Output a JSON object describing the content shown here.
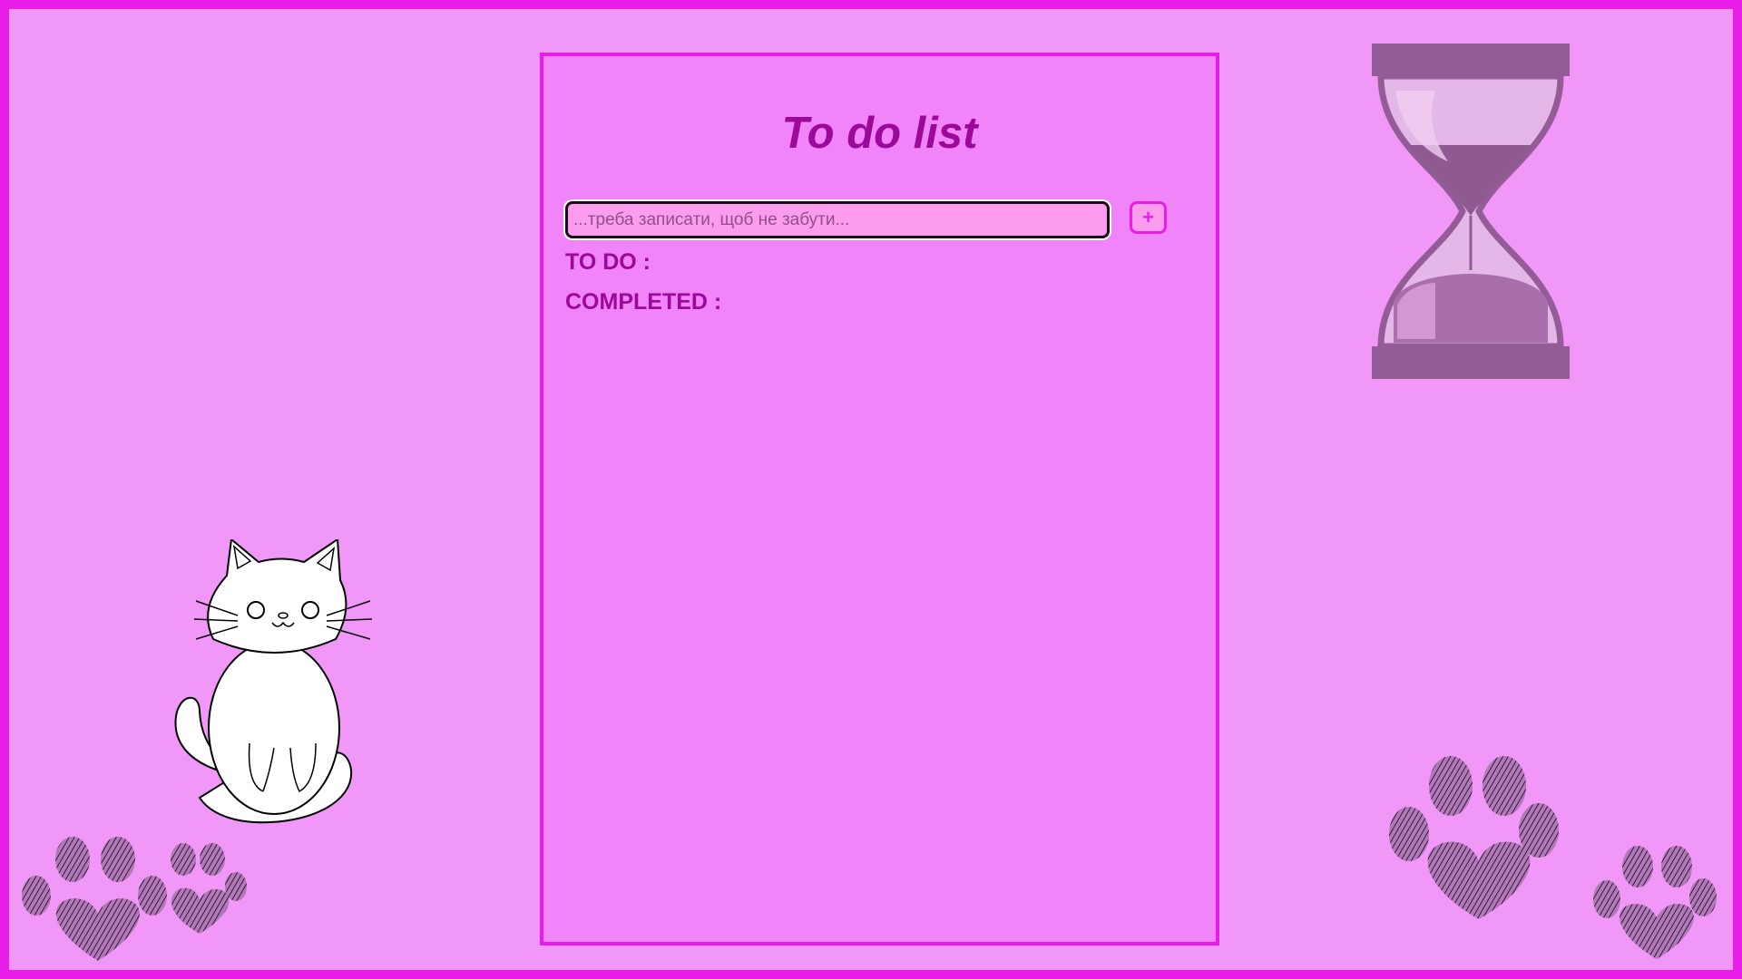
{
  "app": {
    "title": "To do list"
  },
  "input": {
    "placeholder": "...треба записати, щоб не забути...",
    "value": ""
  },
  "add_button": {
    "label": "+"
  },
  "sections": {
    "todo_label": "TO DO :",
    "completed_label": "COMPLETED :"
  },
  "decorations": {
    "cat": "cat-illustration",
    "hourglass": "hourglass-illustration",
    "paws": "paw-prints-icon"
  },
  "colors": {
    "page_background": "#f097f7",
    "frame_border": "#e91de8",
    "card_background": "#f184f8",
    "title_text": "#9c089a",
    "input_background": "#fc9ced",
    "hourglass": "#945c96"
  }
}
